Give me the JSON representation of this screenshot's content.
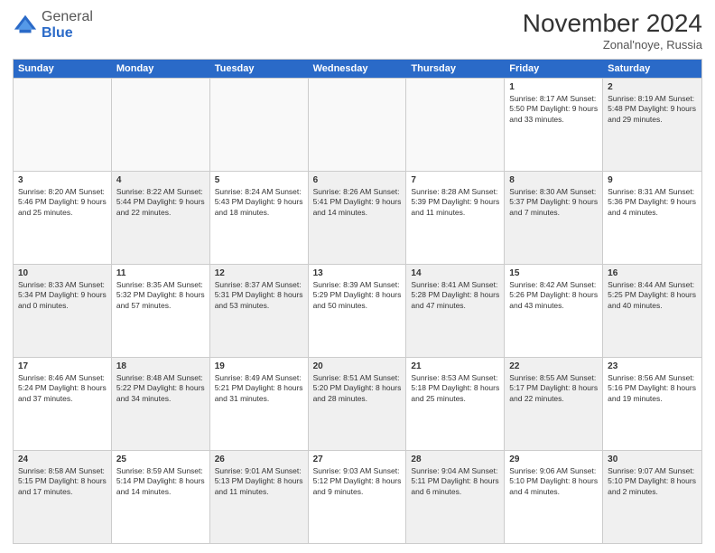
{
  "header": {
    "logo_general": "General",
    "logo_blue": "Blue",
    "month_title": "November 2024",
    "location": "Zonal'noye, Russia"
  },
  "weekdays": [
    "Sunday",
    "Monday",
    "Tuesday",
    "Wednesday",
    "Thursday",
    "Friday",
    "Saturday"
  ],
  "rows": [
    [
      {
        "day": "",
        "info": "",
        "shaded": false,
        "empty": true
      },
      {
        "day": "",
        "info": "",
        "shaded": false,
        "empty": true
      },
      {
        "day": "",
        "info": "",
        "shaded": false,
        "empty": true
      },
      {
        "day": "",
        "info": "",
        "shaded": false,
        "empty": true
      },
      {
        "day": "",
        "info": "",
        "shaded": false,
        "empty": true
      },
      {
        "day": "1",
        "info": "Sunrise: 8:17 AM\nSunset: 5:50 PM\nDaylight: 9 hours and 33 minutes.",
        "shaded": false,
        "empty": false
      },
      {
        "day": "2",
        "info": "Sunrise: 8:19 AM\nSunset: 5:48 PM\nDaylight: 9 hours and 29 minutes.",
        "shaded": true,
        "empty": false
      }
    ],
    [
      {
        "day": "3",
        "info": "Sunrise: 8:20 AM\nSunset: 5:46 PM\nDaylight: 9 hours and 25 minutes.",
        "shaded": false,
        "empty": false
      },
      {
        "day": "4",
        "info": "Sunrise: 8:22 AM\nSunset: 5:44 PM\nDaylight: 9 hours and 22 minutes.",
        "shaded": true,
        "empty": false
      },
      {
        "day": "5",
        "info": "Sunrise: 8:24 AM\nSunset: 5:43 PM\nDaylight: 9 hours and 18 minutes.",
        "shaded": false,
        "empty": false
      },
      {
        "day": "6",
        "info": "Sunrise: 8:26 AM\nSunset: 5:41 PM\nDaylight: 9 hours and 14 minutes.",
        "shaded": true,
        "empty": false
      },
      {
        "day": "7",
        "info": "Sunrise: 8:28 AM\nSunset: 5:39 PM\nDaylight: 9 hours and 11 minutes.",
        "shaded": false,
        "empty": false
      },
      {
        "day": "8",
        "info": "Sunrise: 8:30 AM\nSunset: 5:37 PM\nDaylight: 9 hours and 7 minutes.",
        "shaded": true,
        "empty": false
      },
      {
        "day": "9",
        "info": "Sunrise: 8:31 AM\nSunset: 5:36 PM\nDaylight: 9 hours and 4 minutes.",
        "shaded": false,
        "empty": false
      }
    ],
    [
      {
        "day": "10",
        "info": "Sunrise: 8:33 AM\nSunset: 5:34 PM\nDaylight: 9 hours and 0 minutes.",
        "shaded": true,
        "empty": false
      },
      {
        "day": "11",
        "info": "Sunrise: 8:35 AM\nSunset: 5:32 PM\nDaylight: 8 hours and 57 minutes.",
        "shaded": false,
        "empty": false
      },
      {
        "day": "12",
        "info": "Sunrise: 8:37 AM\nSunset: 5:31 PM\nDaylight: 8 hours and 53 minutes.",
        "shaded": true,
        "empty": false
      },
      {
        "day": "13",
        "info": "Sunrise: 8:39 AM\nSunset: 5:29 PM\nDaylight: 8 hours and 50 minutes.",
        "shaded": false,
        "empty": false
      },
      {
        "day": "14",
        "info": "Sunrise: 8:41 AM\nSunset: 5:28 PM\nDaylight: 8 hours and 47 minutes.",
        "shaded": true,
        "empty": false
      },
      {
        "day": "15",
        "info": "Sunrise: 8:42 AM\nSunset: 5:26 PM\nDaylight: 8 hours and 43 minutes.",
        "shaded": false,
        "empty": false
      },
      {
        "day": "16",
        "info": "Sunrise: 8:44 AM\nSunset: 5:25 PM\nDaylight: 8 hours and 40 minutes.",
        "shaded": true,
        "empty": false
      }
    ],
    [
      {
        "day": "17",
        "info": "Sunrise: 8:46 AM\nSunset: 5:24 PM\nDaylight: 8 hours and 37 minutes.",
        "shaded": false,
        "empty": false
      },
      {
        "day": "18",
        "info": "Sunrise: 8:48 AM\nSunset: 5:22 PM\nDaylight: 8 hours and 34 minutes.",
        "shaded": true,
        "empty": false
      },
      {
        "day": "19",
        "info": "Sunrise: 8:49 AM\nSunset: 5:21 PM\nDaylight: 8 hours and 31 minutes.",
        "shaded": false,
        "empty": false
      },
      {
        "day": "20",
        "info": "Sunrise: 8:51 AM\nSunset: 5:20 PM\nDaylight: 8 hours and 28 minutes.",
        "shaded": true,
        "empty": false
      },
      {
        "day": "21",
        "info": "Sunrise: 8:53 AM\nSunset: 5:18 PM\nDaylight: 8 hours and 25 minutes.",
        "shaded": false,
        "empty": false
      },
      {
        "day": "22",
        "info": "Sunrise: 8:55 AM\nSunset: 5:17 PM\nDaylight: 8 hours and 22 minutes.",
        "shaded": true,
        "empty": false
      },
      {
        "day": "23",
        "info": "Sunrise: 8:56 AM\nSunset: 5:16 PM\nDaylight: 8 hours and 19 minutes.",
        "shaded": false,
        "empty": false
      }
    ],
    [
      {
        "day": "24",
        "info": "Sunrise: 8:58 AM\nSunset: 5:15 PM\nDaylight: 8 hours and 17 minutes.",
        "shaded": true,
        "empty": false
      },
      {
        "day": "25",
        "info": "Sunrise: 8:59 AM\nSunset: 5:14 PM\nDaylight: 8 hours and 14 minutes.",
        "shaded": false,
        "empty": false
      },
      {
        "day": "26",
        "info": "Sunrise: 9:01 AM\nSunset: 5:13 PM\nDaylight: 8 hours and 11 minutes.",
        "shaded": true,
        "empty": false
      },
      {
        "day": "27",
        "info": "Sunrise: 9:03 AM\nSunset: 5:12 PM\nDaylight: 8 hours and 9 minutes.",
        "shaded": false,
        "empty": false
      },
      {
        "day": "28",
        "info": "Sunrise: 9:04 AM\nSunset: 5:11 PM\nDaylight: 8 hours and 6 minutes.",
        "shaded": true,
        "empty": false
      },
      {
        "day": "29",
        "info": "Sunrise: 9:06 AM\nSunset: 5:10 PM\nDaylight: 8 hours and 4 minutes.",
        "shaded": false,
        "empty": false
      },
      {
        "day": "30",
        "info": "Sunrise: 9:07 AM\nSunset: 5:10 PM\nDaylight: 8 hours and 2 minutes.",
        "shaded": true,
        "empty": false
      }
    ]
  ]
}
